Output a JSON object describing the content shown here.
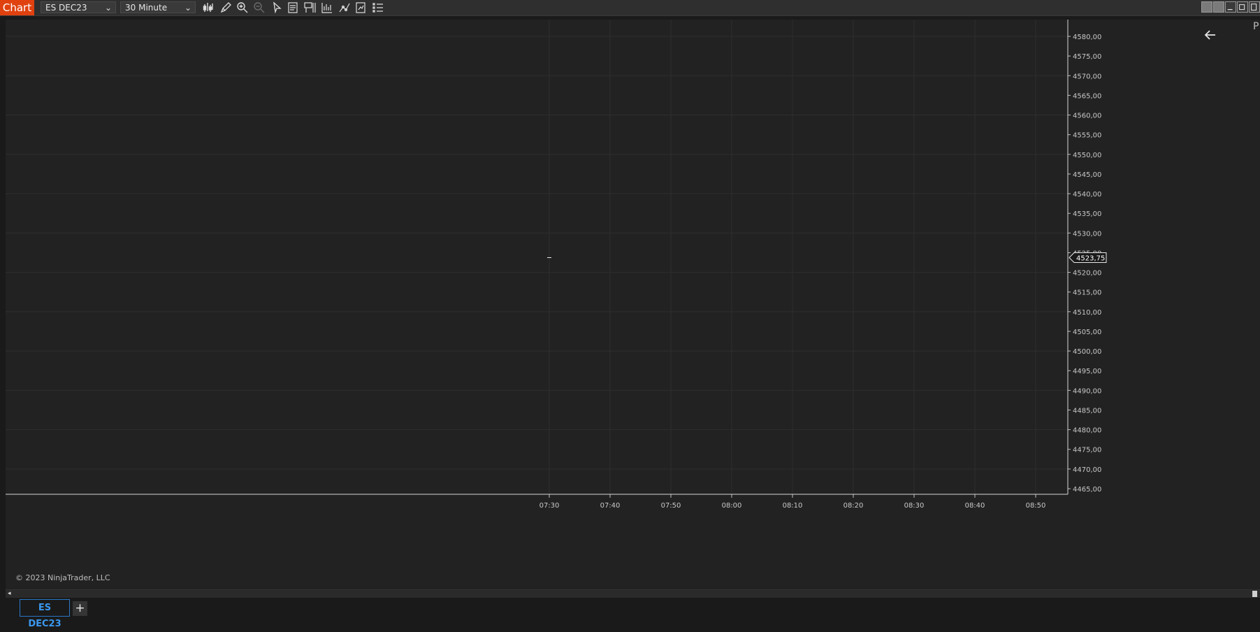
{
  "toolbar": {
    "app_label": "Chart",
    "instrument": "ES DEC23",
    "interval": "30 Minute",
    "tools": [
      "bar-type-icon",
      "draw-pencil-icon",
      "zoom-in-icon",
      "zoom-out-icon",
      "pointer-icon",
      "data-box-icon",
      "chart-trader-icon",
      "strategies-icon",
      "indicators-icon",
      "properties-icon",
      "list-icon"
    ],
    "accent": "#e0410f"
  },
  "chart_data": {
    "type": "line",
    "x": [
      "07:30",
      "07:40",
      "07:50",
      "08:00",
      "08:10",
      "08:20",
      "08:30",
      "08:40",
      "08:50"
    ],
    "y_ticks": [
      "4580,00",
      "4575,00",
      "4570,00",
      "4565,00",
      "4560,00",
      "4555,00",
      "4550,00",
      "4545,00",
      "4540,00",
      "4535,00",
      "4530,00",
      "4525,00",
      "4520,00",
      "4515,00",
      "4510,00",
      "4505,00",
      "4500,00",
      "4495,00",
      "4490,00",
      "4485,00",
      "4480,00",
      "4475,00",
      "4470,00",
      "4465,00"
    ],
    "ylim": [
      4465,
      4580
    ],
    "series": [
      {
        "points": [
          {
            "x": "07:30",
            "y": 4523.75
          }
        ]
      }
    ],
    "last_price_label": "4523,75",
    "last_price": 4523.75,
    "grid": true
  },
  "chart": {
    "copyright": "© 2023 NinjaTrader, LLC",
    "panel_letter": "P"
  },
  "tabs": [
    {
      "label": "ES DEC23",
      "active": true
    }
  ],
  "add_tab_label": "+",
  "colors": {
    "background": "#222222",
    "grid": "#2e2e2e",
    "axis_text": "#c8c8c8",
    "active_tab": "#3a98f0"
  }
}
